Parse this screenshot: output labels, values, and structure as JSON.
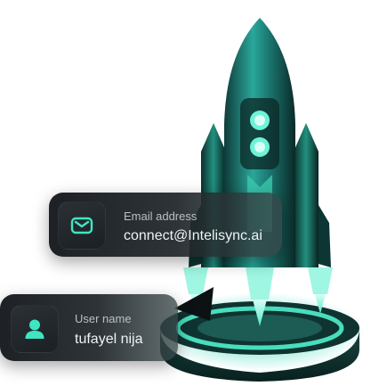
{
  "email_card": {
    "label": "Email address",
    "value": "connect@Intelisync.ai",
    "icon": "envelope-icon"
  },
  "user_card": {
    "label": "User name",
    "value": "tufayel nija",
    "icon": "user-icon"
  },
  "colors": {
    "accent": "#3ee6c1",
    "card_bg": "#1b2024",
    "rocket_teal": "#1f8f86"
  }
}
